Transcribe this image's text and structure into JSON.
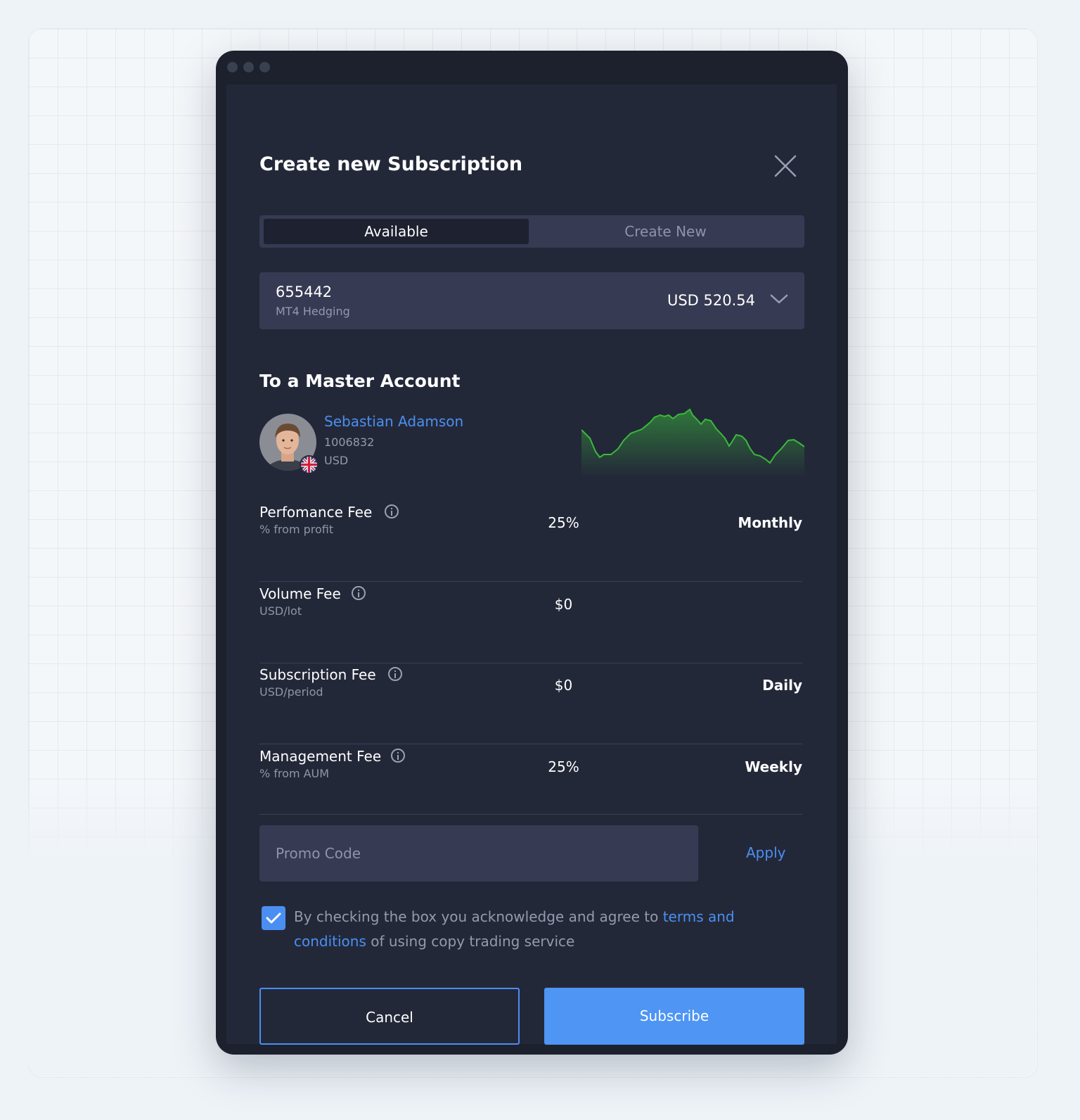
{
  "modal": {
    "title": "Create new Subscription",
    "tabs": {
      "active": "Available",
      "inactive": "Create New"
    },
    "account": {
      "number": "655442",
      "type": "MT4 Hedging",
      "balance": "USD 520.54"
    },
    "section_title": "To a Master Account",
    "master": {
      "name": "Sebastian Adamson",
      "id": "1006832",
      "currency": "USD"
    },
    "fees": [
      {
        "label": "Perfomance Fee",
        "sub": "% from profit",
        "value": "25%",
        "period": "Monthly"
      },
      {
        "label": "Volume Fee",
        "sub": "USD/lot",
        "value": "$0",
        "period": ""
      },
      {
        "label": "Subscription Fee",
        "sub": "USD/period",
        "value": "$0",
        "period": "Daily"
      },
      {
        "label": "Management Fee",
        "sub": "% from AUM",
        "value": "25%",
        "period": "Weekly"
      }
    ],
    "promo": {
      "placeholder": "Promo Code",
      "value": "",
      "apply": "Apply"
    },
    "terms": {
      "checked": true,
      "before": "By checking the box you acknowledge and agree to ",
      "link": "terms and conditions",
      "after": " of using copy  trading service"
    },
    "buttons": {
      "cancel": "Cancel",
      "subscribe": "Subscribe"
    }
  },
  "colors": {
    "accent": "#4e95f4",
    "link": "#4a90f0",
    "panel": "#232839",
    "sparkline": "#3ab93a"
  },
  "icons": {
    "close": "close-icon",
    "dropdown": "chevron-down-icon",
    "info": "info-icon",
    "check": "check-icon",
    "flag": "uk-flag-icon"
  }
}
